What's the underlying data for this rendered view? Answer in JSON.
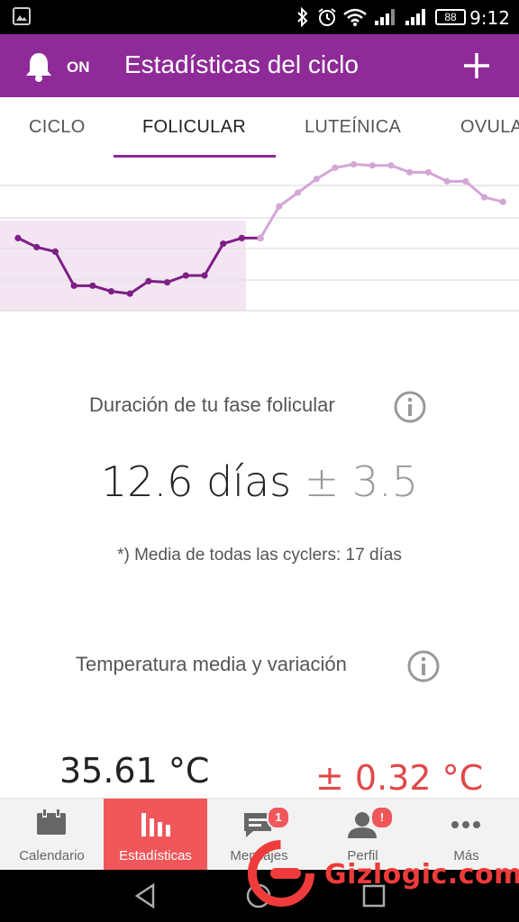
{
  "status_bar": {
    "time": "9:12",
    "battery": "88",
    "icons": [
      "image-icon",
      "bluetooth-icon",
      "alarm-icon",
      "wifi-icon",
      "signal-icon",
      "signal-icon-2"
    ]
  },
  "app_bar": {
    "notify_label": "ON",
    "title": "Estadísticas del ciclo",
    "color": "#8e2b98"
  },
  "tabs": [
    {
      "label": "CICLO"
    },
    {
      "label": "FOLICULAR"
    },
    {
      "label": "LUTEÍNICA"
    },
    {
      "label": "OVULA"
    }
  ],
  "active_tab": "FOLICULAR",
  "chart_data": {
    "type": "line",
    "grid": true,
    "highlighted_phase_days": [
      1,
      14
    ],
    "series": [
      {
        "style": "dark-purple-dotted",
        "x": [
          1,
          2,
          3,
          4,
          5,
          6,
          7,
          8,
          9,
          10,
          11,
          12,
          13,
          14
        ],
        "values": [
          0.6,
          0.52,
          0.48,
          0.18,
          0.18,
          0.13,
          0.11,
          0.22,
          0.21,
          0.27,
          0.27,
          0.55,
          0.6,
          0.6
        ]
      },
      {
        "style": "light-purple-dotted",
        "x": [
          14,
          15,
          16,
          17,
          18,
          19,
          20,
          21,
          22,
          23,
          24,
          25,
          26,
          27
        ],
        "values": [
          0.6,
          0.88,
          1.0,
          1.12,
          1.22,
          1.25,
          1.24,
          1.24,
          1.18,
          1.18,
          1.1,
          1.1,
          0.96,
          0.92
        ]
      }
    ]
  },
  "follicular": {
    "title": "Duración de tu fase folicular",
    "value": "12.6 días",
    "variation": "± 3.5",
    "note": "*) Media de todas las cyclers: 17 días"
  },
  "temperature": {
    "title": "Temperatura media y variación",
    "mean": "35.61 °C",
    "variation": "± 0.32 °C",
    "variation_color": "#e04848"
  },
  "bottom_nav": [
    {
      "label": "Calendario",
      "icon": "calendar-icon"
    },
    {
      "label": "Estadísticas",
      "icon": "bar-chart-icon"
    },
    {
      "label": "Mensajes",
      "icon": "messages-icon",
      "badge": "1"
    },
    {
      "label": "Perfil",
      "icon": "profile-icon",
      "badge": "!"
    },
    {
      "label": "Más",
      "icon": "more-icon"
    }
  ],
  "active_nav": "Estadísticas",
  "watermark": "Gizlogic.com"
}
